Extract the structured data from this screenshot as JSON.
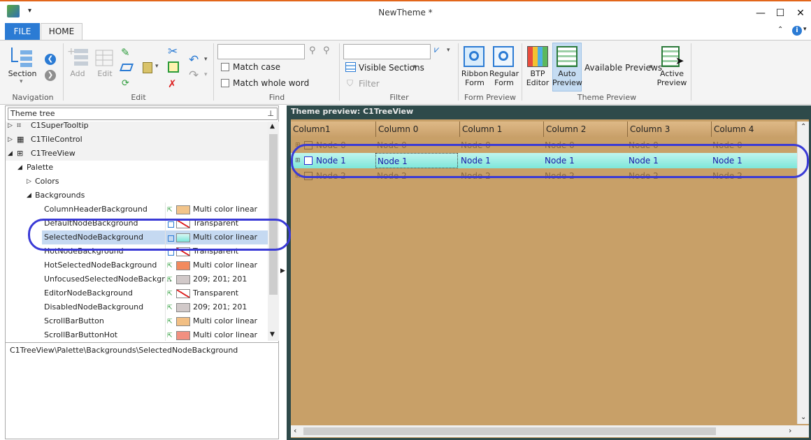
{
  "window": {
    "title": "NewTheme *",
    "minimize": "—",
    "maximize": "☐",
    "close": "✕"
  },
  "tabs": {
    "file": "FILE",
    "home": "HOME"
  },
  "ribbon": {
    "navigation": {
      "section": "Section",
      "group": "Navigation"
    },
    "edit": {
      "add": "Add",
      "edit": "Edit",
      "group": "Edit"
    },
    "find": {
      "input": "",
      "match_case": "Match case",
      "match_whole_word": "Match whole word",
      "group": "Find"
    },
    "filter": {
      "input": "",
      "visible_sections": "Visible Sections",
      "filter": "Filter",
      "group": "Filter"
    },
    "form_preview": {
      "ribbon_form_l1": "Ribbon",
      "ribbon_form_l2": "Form",
      "regular_form_l1": "Regular",
      "regular_form_l2": "Form",
      "group": "Form Preview"
    },
    "theme_preview": {
      "btp_l1": "BTP",
      "btp_l2": "Editor",
      "auto_l1": "Auto",
      "auto_l2": "Preview",
      "available_previews": "Available Previews",
      "active_l1": "Active",
      "active_l2": "Preview",
      "group": "Theme Preview"
    }
  },
  "tree": {
    "header": "Theme tree",
    "nodes": [
      {
        "label": "C1SuperTooltip"
      },
      {
        "label": "C1TileControl"
      },
      {
        "label": "C1TreeView"
      },
      {
        "label": "Palette"
      },
      {
        "label": "Colors"
      },
      {
        "label": "Backgrounds"
      }
    ],
    "props": [
      {
        "name": "ColumnHeaderBackground",
        "value": "Multi color linear",
        "swatch": "#f2c48a"
      },
      {
        "name": "DefaultNodeBackground",
        "value": "Transparent",
        "swatch": "transparent"
      },
      {
        "name": "SelectedNodeBackground",
        "value": "Multi color linear",
        "swatch": "#a8ece6"
      },
      {
        "name": "HotNodeBackground",
        "value": "Transparent",
        "swatch": "transparent"
      },
      {
        "name": "HotSelectedNodeBackground",
        "value": "Multi color linear",
        "swatch": "#f28a5e"
      },
      {
        "name": "UnfocusedSelectedNodeBackgr...",
        "value": "209; 201; 201",
        "swatch": "#d1c9c9"
      },
      {
        "name": "EditorNodeBackground",
        "value": "Transparent",
        "swatch": "transparent"
      },
      {
        "name": "DisabledNodeBackground",
        "value": "209; 201; 201",
        "swatch": "#d1c9c9"
      },
      {
        "name": "ScrollBarButton",
        "value": "Multi color linear",
        "swatch": "#f2bf84"
      },
      {
        "name": "ScrollBarButtonHot",
        "value": "Multi color linear",
        "swatch": "#f29080"
      }
    ],
    "path": "C1TreeView\\Palette\\Backgrounds\\SelectedNodeBackground"
  },
  "preview": {
    "header": "Theme preview: C1TreeView",
    "columns": [
      "Column1",
      "Column 0",
      "Column 1",
      "Column 2",
      "Column 3",
      "Column 4"
    ],
    "rows": [
      {
        "cells": [
          "Node 0",
          "Node 0",
          "Node 0",
          "Node 0",
          "Node 0",
          "Node 0"
        ]
      },
      {
        "cells": [
          "Node 1",
          "Node 1",
          "Node 1",
          "Node 1",
          "Node 1",
          "Node 1"
        ]
      },
      {
        "cells": [
          "Node 2",
          "Node 2",
          "Node 2",
          "Node 2",
          "Node 2",
          "Node 2"
        ]
      }
    ]
  },
  "colors": {
    "file_tab": "#2b7bd4",
    "preview_bg": "#c8a068",
    "selected_row": "#7de6da",
    "annotation": "#3a3ad6"
  }
}
